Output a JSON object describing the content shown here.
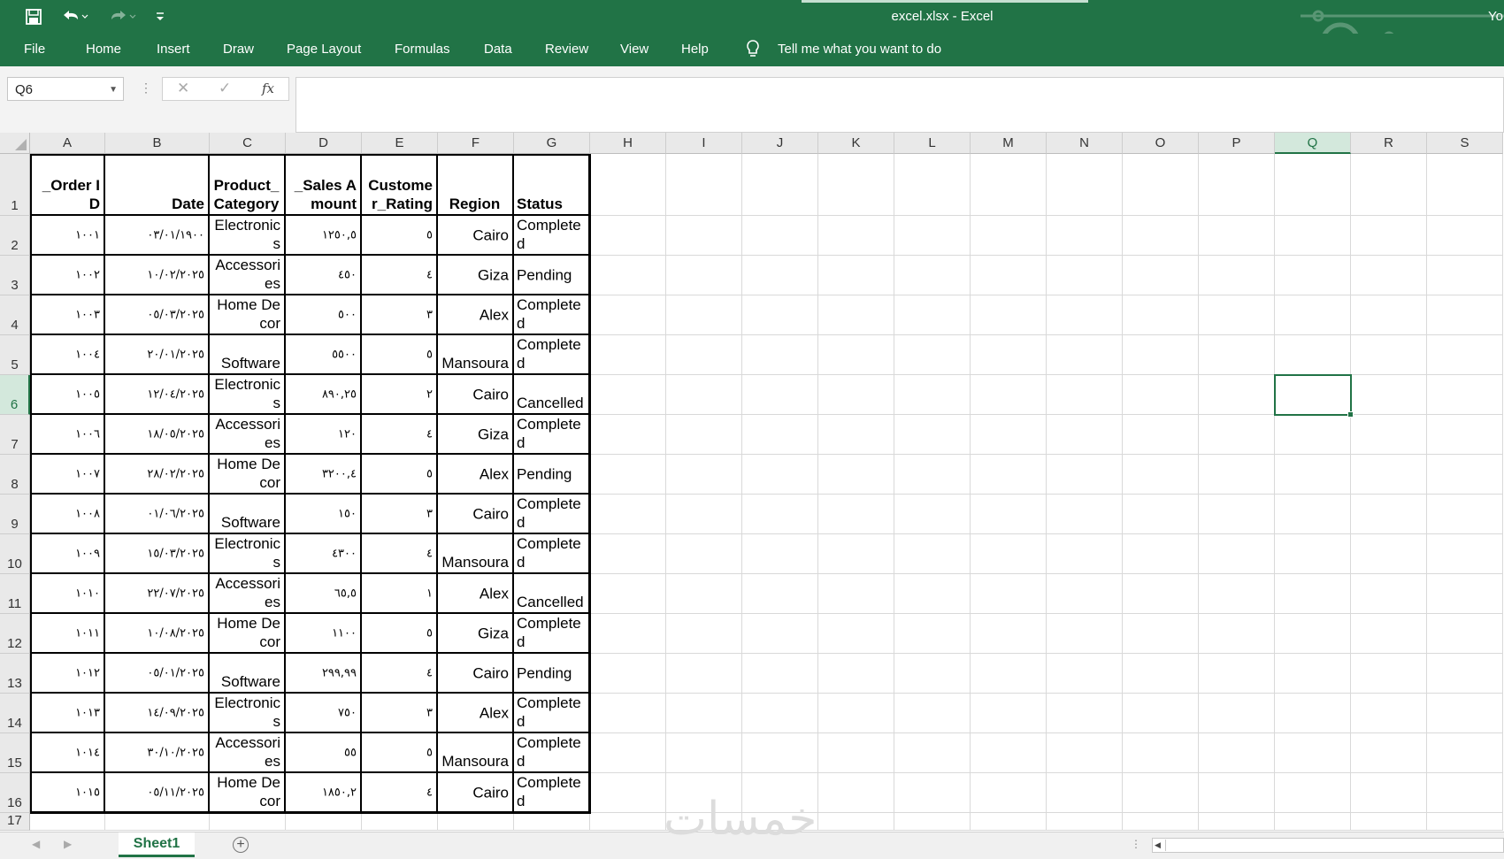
{
  "app": {
    "window_title": "excel.xlsx  -  Excel",
    "user_initials": "Yo",
    "accent": "#217346"
  },
  "quick_access": {
    "save_icon": "save-icon",
    "undo_icon": "undo-icon",
    "redo_icon": "redo-icon",
    "customize_icon": "customize-qat-icon"
  },
  "menu": {
    "items": [
      "File",
      "Home",
      "Insert",
      "Draw",
      "Page Layout",
      "Formulas",
      "Data",
      "Review",
      "View",
      "Help"
    ],
    "tell_me": "Tell me what you want to do"
  },
  "formula_bar": {
    "name_box": "Q6",
    "fx": "fx",
    "formula": ""
  },
  "grid": {
    "columns": [
      "A",
      "B",
      "C",
      "D",
      "E",
      "F",
      "G",
      "H",
      "I",
      "J",
      "K",
      "L",
      "M",
      "N",
      "O",
      "P",
      "Q",
      "R",
      "S"
    ],
    "rows": [
      "1",
      "2",
      "3",
      "4",
      "5",
      "6",
      "7",
      "8",
      "9",
      "10",
      "11",
      "12",
      "13",
      "14",
      "15",
      "16",
      "17"
    ],
    "selected_cell": "Q6",
    "headers": [
      "_Order ID",
      "Date",
      "Product_Category",
      "_Sales Amount",
      "Customer_Rating",
      "Region",
      "Status"
    ],
    "data": [
      [
        "١٠٠١",
        "٠٣/٠١/١٩٠٠",
        "Electronics",
        "١٢٥٠,٥",
        "٥",
        "Cairo",
        "Completed"
      ],
      [
        "١٠٠٢",
        "١٠/٠٢/٢٠٢٥",
        "Accessories",
        "٤٥٠",
        "٤",
        "Giza",
        "Pending"
      ],
      [
        "١٠٠٣",
        "٠٥/٠٣/٢٠٢٥",
        "Home Decor",
        "٥٠٠",
        "٣",
        "Alex",
        "Completed"
      ],
      [
        "١٠٠٤",
        "٢٠/٠١/٢٠٢٥",
        "Software",
        "٥٥٠٠",
        "٥",
        "Mansoura",
        "Completed"
      ],
      [
        "١٠٠٥",
        "١٢/٠٤/٢٠٢٥",
        "Electronics",
        "٨٩٠,٢٥",
        "٢",
        "Cairo",
        "Cancelled"
      ],
      [
        "١٠٠٦",
        "١٨/٠٥/٢٠٢٥",
        "Accessories",
        "١٢٠",
        "٤",
        "Giza",
        "Completed"
      ],
      [
        "١٠٠٧",
        "٢٨/٠٢/٢٠٢٥",
        "Home Decor",
        "٣٢٠٠,٤",
        "٥",
        "Alex",
        "Pending"
      ],
      [
        "١٠٠٨",
        "٠١/٠٦/٢٠٢٥",
        "Software",
        "١٥٠",
        "٣",
        "Cairo",
        "Completed"
      ],
      [
        "١٠٠٩",
        "١٥/٠٣/٢٠٢٥",
        "Electronics",
        "٤٣٠٠",
        "٤",
        "Mansoura",
        "Completed"
      ],
      [
        "١٠١٠",
        "٢٢/٠٧/٢٠٢٥",
        "Accessories",
        "٦٥,٥",
        "١",
        "Alex",
        "Cancelled"
      ],
      [
        "١٠١١",
        "١٠/٠٨/٢٠٢٥",
        "Home Decor",
        "١١٠٠",
        "٥",
        "Giza",
        "Completed"
      ],
      [
        "١٠١٢",
        "٠٥/٠١/٢٠٢٥",
        "Software",
        "٢٩٩,٩٩",
        "٤",
        "Cairo",
        "Pending"
      ],
      [
        "١٠١٣",
        "١٤/٠٩/٢٠٢٥",
        "Electronics",
        "٧٥٠",
        "٣",
        "Alex",
        "Completed"
      ],
      [
        "١٠١٤",
        "٣٠/١٠/٢٠٢٥",
        "Accessories",
        "٥٥",
        "٥",
        "Mansoura",
        "Completed"
      ],
      [
        "١٠١٥",
        "٠٥/١١/٢٠٢٥",
        "Home Decor",
        "١٨٥٠,٢",
        "٤",
        "Cairo",
        "Completed"
      ]
    ]
  },
  "sheets": {
    "tabs": [
      "Sheet1"
    ],
    "active": "Sheet1"
  },
  "watermark": "خمسات"
}
